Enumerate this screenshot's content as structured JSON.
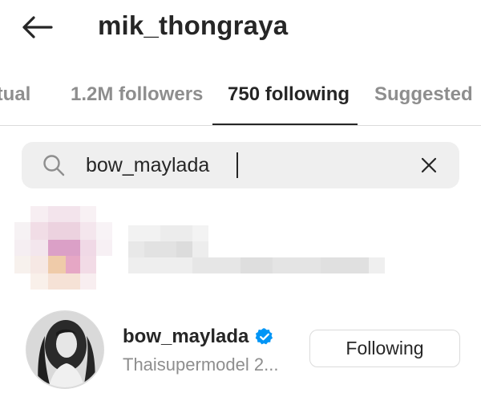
{
  "header": {
    "title": "mik_thongraya",
    "back_icon": "arrow-left-icon"
  },
  "tabs": [
    {
      "label": "utual",
      "active": false
    },
    {
      "label": "1.2M followers",
      "active": false
    },
    {
      "label": "750 following",
      "active": true
    },
    {
      "label": "Suggested",
      "active": false
    }
  ],
  "search": {
    "value": "bow_maylada",
    "icon": "search-icon",
    "clear_icon": "close-icon"
  },
  "results": [
    {
      "username": "bow_maylada",
      "verified": true,
      "bio": "Thaisupermodel 2...",
      "button_label": "Following"
    }
  ],
  "colors": {
    "text_primary": "#262626",
    "text_secondary": "#8e8e8e",
    "search_bg": "#efefef",
    "verified_blue": "#0095f6",
    "divider": "#dbdbdb"
  }
}
